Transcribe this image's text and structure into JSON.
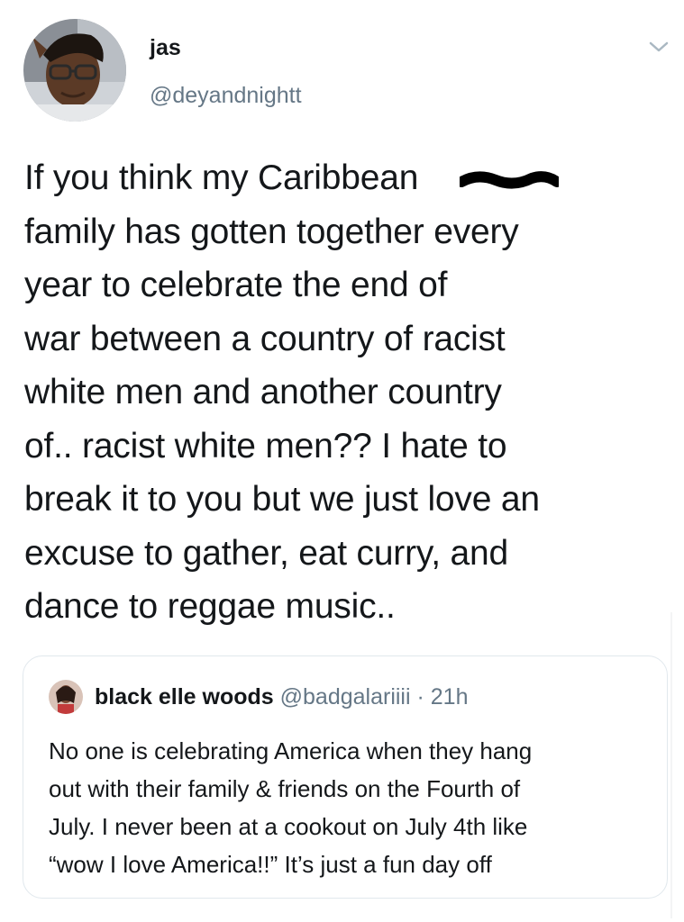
{
  "author": {
    "display_name": "jas",
    "handle": "@deyandnightt",
    "avatar_icon": "profile-photo"
  },
  "menu": {
    "icon": "chevron-down-icon"
  },
  "tweet": {
    "text": "If you think my Caribbean\nfamily has gotten together every\nyear to celebrate the end of\nwar between a country of racist\nwhite men and another country\nof.. racist white men?? I hate to\nbreak it to you but we just love an\nexcuse to gather, eat curry, and\ndance to reggae music.."
  },
  "quoted_tweet": {
    "display_name": "black elle woods",
    "handle": "@badgalariiii",
    "separator": "·",
    "time": "21h",
    "text": "No one is celebrating America when they hang\nout with their family & friends on the Fourth of\nJuly. I never been at a cookout on July 4th like\n“wow I love America!!” It’s just a fun day off"
  },
  "colors": {
    "text_primary": "#14171a",
    "text_secondary": "#657786",
    "border": "#e1e8ed"
  }
}
